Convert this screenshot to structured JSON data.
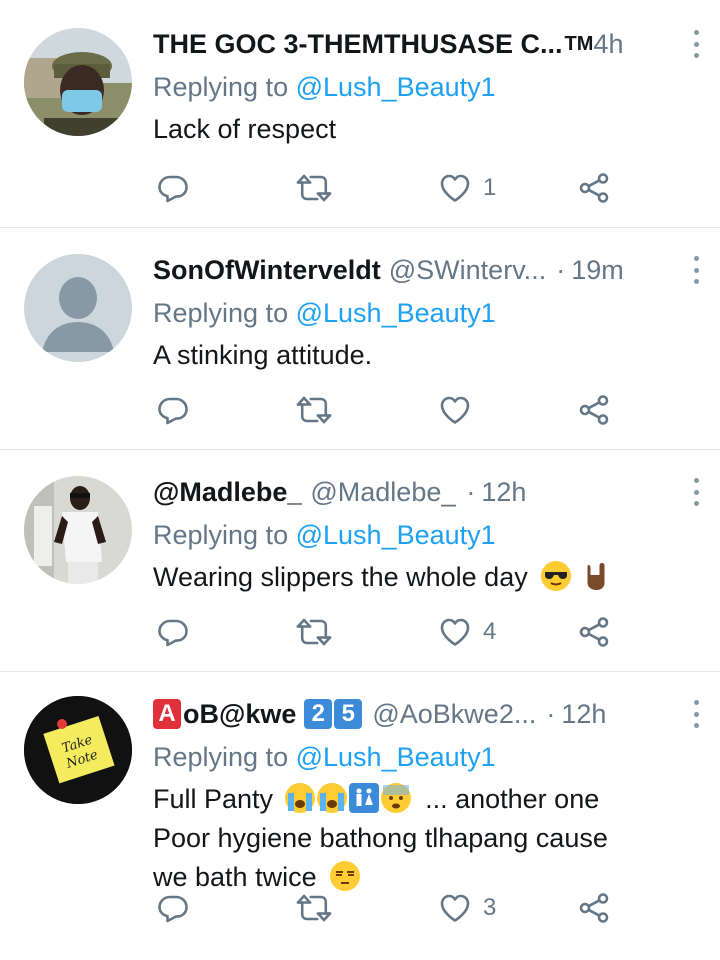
{
  "colors": {
    "handle_gray": "#657786",
    "mention_blue": "#1da1f2",
    "icon_gray": "#657786",
    "divider": "#e1e8ed"
  },
  "tweets": [
    {
      "name": "THE GOC 3-THEMTHUSASE C...",
      "handle": "",
      "time_prefix": "TM",
      "time": "4h",
      "reply_label": "Replying to",
      "reply_handle": "@Lush_Beauty1",
      "text": "Lack of respect",
      "reply_count": "",
      "retweet_count": "",
      "like_count": "1",
      "avatar": "man-in-cap-and-mask"
    },
    {
      "name": "SonOfWinterveldt",
      "handle": "@SWinterv...",
      "time": "19m",
      "reply_label": "Replying to",
      "reply_handle": "@Lush_Beauty1",
      "text": "A stinking attitude.",
      "reply_count": "",
      "retweet_count": "",
      "like_count": "",
      "avatar": "default-avatar"
    },
    {
      "name": "@Madlebe_",
      "handle": "@Madlebe_",
      "time": "12h",
      "reply_label": "Replying to",
      "reply_handle": "@Lush_Beauty1",
      "text": "Wearing slippers the whole day",
      "emojis": [
        "smiling-face-with-sunglasses",
        "sign-of-horns"
      ],
      "reply_count": "",
      "retweet_count": "",
      "like_count": "4",
      "avatar": "man-white-tshirt"
    },
    {
      "name_badge_letter": "A",
      "name": "oB@kwe",
      "name_digits": [
        "2",
        "5"
      ],
      "handle": "@AoBkwe2...",
      "time": "12h",
      "reply_label": "Replying to",
      "reply_handle": "@Lush_Beauty1",
      "text_line1": "Full Panty",
      "text_line1_emojis": [
        "loudly-crying-face",
        "loudly-crying-face",
        "restroom-symbol",
        "anxious-face-with-sweat"
      ],
      "text_line1_tail": "... another one",
      "text_line2": "Poor hygiene bathong tlhapang cause",
      "text_line3": "we bath twice",
      "text_line3_emojis": [
        "unamused-face"
      ],
      "reply_count": "",
      "retweet_count": "",
      "like_count": "3",
      "avatar": "take-note-sticky"
    }
  ]
}
